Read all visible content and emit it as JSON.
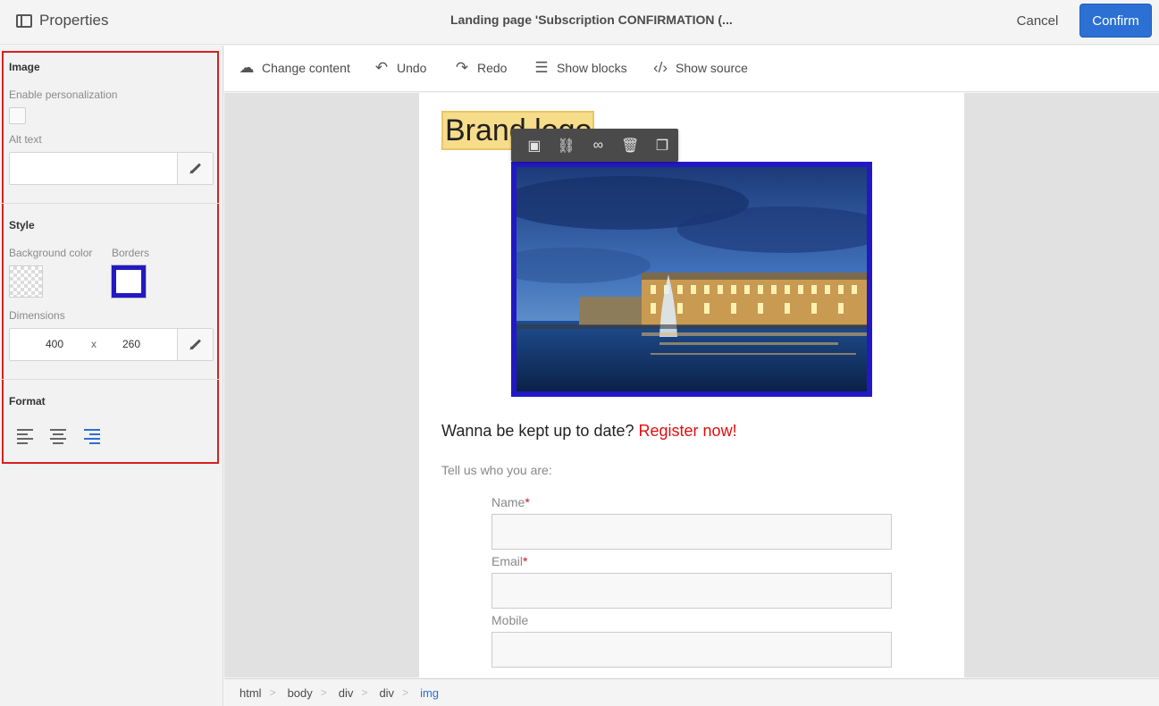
{
  "header": {
    "panel_title": "Properties",
    "doc_title": "Landing page 'Subscription CONFIRMATION (...",
    "cancel_label": "Cancel",
    "confirm_label": "Confirm"
  },
  "panel": {
    "image_section": "Image",
    "enable_personalization_label": "Enable personalization",
    "enable_personalization_checked": false,
    "alt_text_label": "Alt text",
    "alt_text_value": "",
    "style_section": "Style",
    "background_color_label": "Background color",
    "borders_label": "Borders",
    "border_color": "#2219c4",
    "dimensions_label": "Dimensions",
    "width": "400",
    "separator": "x",
    "height": "260",
    "format_section": "Format",
    "alignment_selected": "right"
  },
  "toolbar": {
    "items": [
      {
        "label": "Change content",
        "icon": "cloud-upload-icon"
      },
      {
        "label": "Undo",
        "icon": "undo-icon"
      },
      {
        "label": "Redo",
        "icon": "redo-icon"
      },
      {
        "label": "Show blocks",
        "icon": "blocks-icon"
      },
      {
        "label": "Show source",
        "icon": "code-icon"
      }
    ]
  },
  "canvas": {
    "brand_logo": "Brand logo",
    "image_toolbar_icons": [
      "image-icon",
      "link-icon",
      "creative-cloud-icon",
      "trash-icon",
      "copy-icon"
    ],
    "headline_text": "Wanna be kept up to date?",
    "headline_link": "Register now!",
    "intro_text": "Tell us who you are:",
    "fields": [
      {
        "label": "Name",
        "required": "*"
      },
      {
        "label": "Email",
        "required": "*"
      },
      {
        "label": "Mobile",
        "required": ""
      }
    ]
  },
  "breadcrumb": {
    "items": [
      "html",
      "body",
      "div",
      "div",
      "img"
    ],
    "separator": ">"
  },
  "colors": {
    "accent": "#2c70d4",
    "highlight_border": "#d6201f",
    "link_red": "#e10d0d"
  }
}
